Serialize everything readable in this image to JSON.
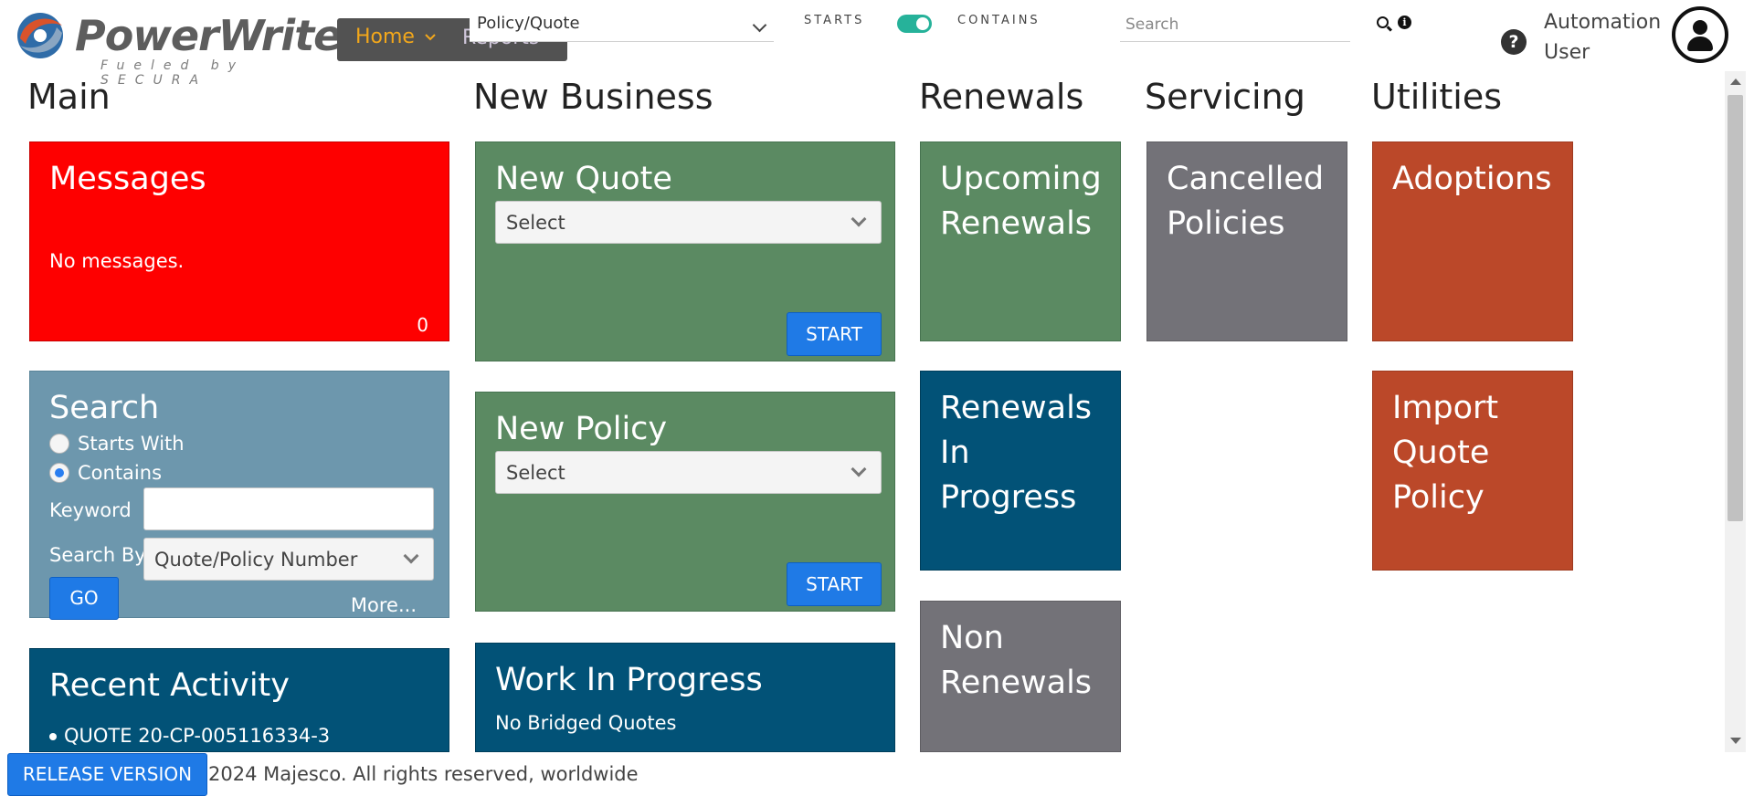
{
  "header": {
    "logo_text": "PowerWriter",
    "logo_tagline": "Fueled by SECURA",
    "nav": {
      "home": "Home",
      "reports": "Reports"
    },
    "policy_quote_select": "Policy/Quote",
    "toggle": {
      "left_label": "STARTS",
      "right_label": "CONTAINS",
      "on": true
    },
    "search_placeholder": "Search",
    "user": {
      "line1": "Automation",
      "line2": "User"
    },
    "icons": [
      "search-icon",
      "info-icon",
      "help-icon",
      "avatar-icon",
      "chevron-down-icon"
    ]
  },
  "columns": {
    "main": "Main",
    "new_business": "New Business",
    "renewals": "Renewals",
    "servicing": "Servicing",
    "utilities": "Utilities"
  },
  "main": {
    "messages": {
      "title": "Messages",
      "text": "No messages.",
      "count": "0"
    },
    "search": {
      "title": "Search",
      "options": [
        {
          "label": "Starts With",
          "selected": false
        },
        {
          "label": "Contains",
          "selected": true
        }
      ],
      "keyword_label": "Keyword",
      "keyword_value": "",
      "search_by_label": "Search By",
      "search_by_value": "Quote/Policy Number",
      "go_label": "GO",
      "more_label": "More..."
    },
    "recent_activity": {
      "title": "Recent Activity",
      "items": [
        "QUOTE 20-CP-005116334-3"
      ]
    }
  },
  "new_business": {
    "new_quote": {
      "title": "New Quote",
      "select": "Select",
      "start": "START"
    },
    "new_policy": {
      "title": "New Policy",
      "select": "Select",
      "start": "START"
    },
    "work_in_progress": {
      "title": "Work In Progress",
      "text": "No Bridged Quotes"
    }
  },
  "renewals": {
    "upcoming": {
      "line1": "Upcoming",
      "line2": "Renewals"
    },
    "in_progress": {
      "line1": "Renewals",
      "line2": "In",
      "line3": "Progress"
    },
    "non_renewals": {
      "line1": "Non",
      "line2": "Renewals"
    }
  },
  "servicing": {
    "cancelled": {
      "line1": "Cancelled",
      "line2": "Policies"
    }
  },
  "utilities": {
    "adoptions": {
      "line1": "Adoptions"
    },
    "import": {
      "line1": "Import",
      "line2": "Quote",
      "line3": "Policy"
    }
  },
  "footer": {
    "release_button": "RELEASE VERSION",
    "copyright": "2024 Majesco. All rights reserved, worldwide"
  },
  "colors": {
    "messages": "#fe0000",
    "search": "#6d97ad",
    "navy": "#025277",
    "green": "#5b8a62",
    "gray": "#737278",
    "orange": "#bb4829",
    "button_blue": "#1f7ae6",
    "nav_home": "#f2a71b",
    "toggle": "#26b29a"
  }
}
